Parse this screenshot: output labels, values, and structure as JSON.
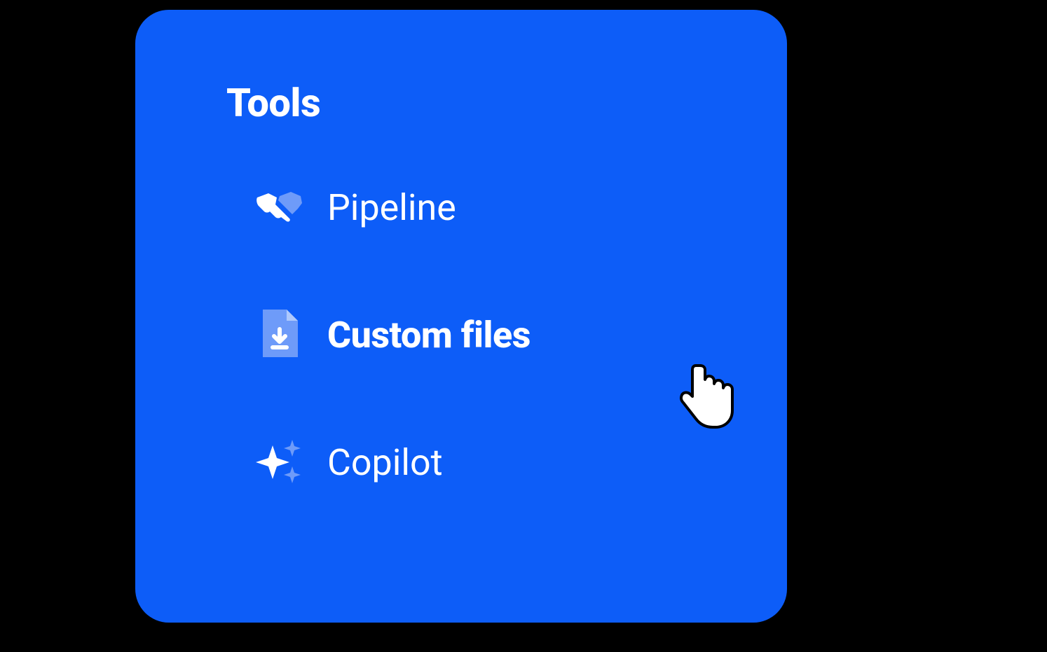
{
  "section": {
    "title": "Tools"
  },
  "menu": {
    "items": [
      {
        "label": "Pipeline",
        "icon": "handshake",
        "hovered": false
      },
      {
        "label": "Custom files",
        "icon": "file-download",
        "hovered": true
      },
      {
        "label": "Copilot",
        "icon": "sparkles",
        "hovered": false
      }
    ]
  },
  "colors": {
    "panel_bg": "#0D5DF8",
    "text": "#ffffff",
    "icon_tint": "#6E9BF9"
  }
}
